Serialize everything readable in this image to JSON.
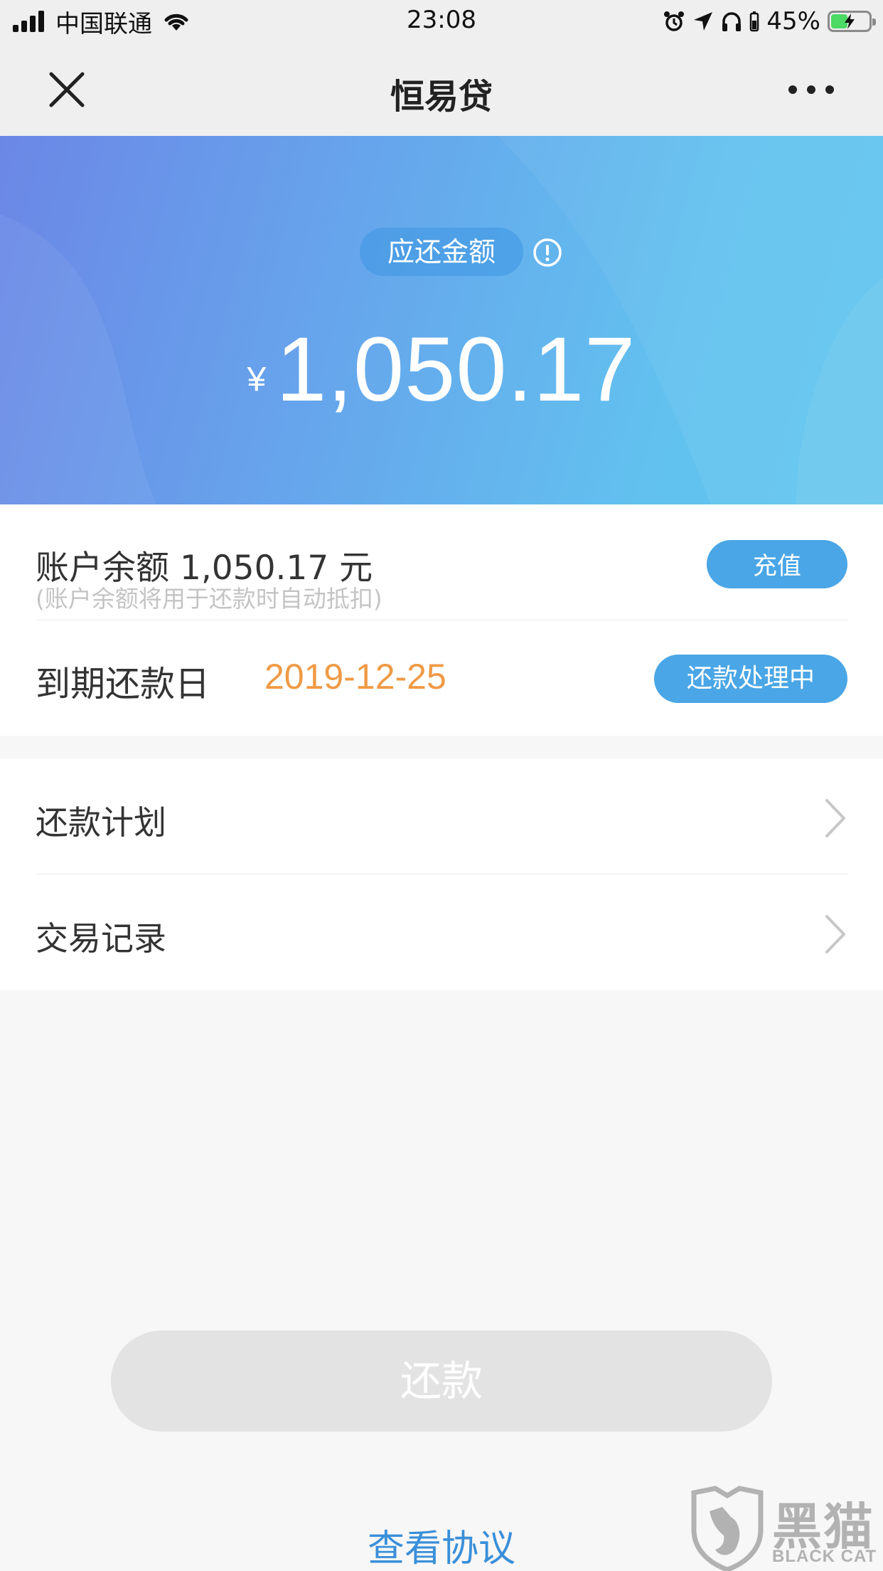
{
  "status_bar": {
    "carrier": "中国联通",
    "time": "23:08",
    "battery_percent": "45%",
    "battery_level": 0.45
  },
  "nav": {
    "title": "恒易贷",
    "close_icon": "close-icon",
    "more_icon": "more-dots-icon"
  },
  "banner": {
    "due_label": "应还金额",
    "currency_symbol": "¥",
    "amount": "1,050.17",
    "colors": {
      "gradient_start": "#6b87e6",
      "gradient_end": "#63c6ef"
    }
  },
  "account": {
    "balance_text": "账户余额 1,050.17 元",
    "balance_note": "(账户余额将用于还款时自动抵扣)",
    "topup_label": "充值",
    "due_date_label": "到期还款日",
    "due_date": "2019-12-25",
    "status_label": "还款处理中"
  },
  "menu": {
    "items": [
      {
        "label": "还款计划"
      },
      {
        "label": "交易记录"
      }
    ]
  },
  "actions": {
    "repay_label": "还款",
    "agreement_label": "查看协议"
  },
  "watermark": {
    "text_cn": "黑猫",
    "text_en": "BLACK CAT"
  },
  "colors": {
    "accent_blue": "#4aa6e6",
    "date_orange": "#ef9a45",
    "link_blue": "#3a8fd9",
    "disabled_gray": "#e3e3e3"
  }
}
